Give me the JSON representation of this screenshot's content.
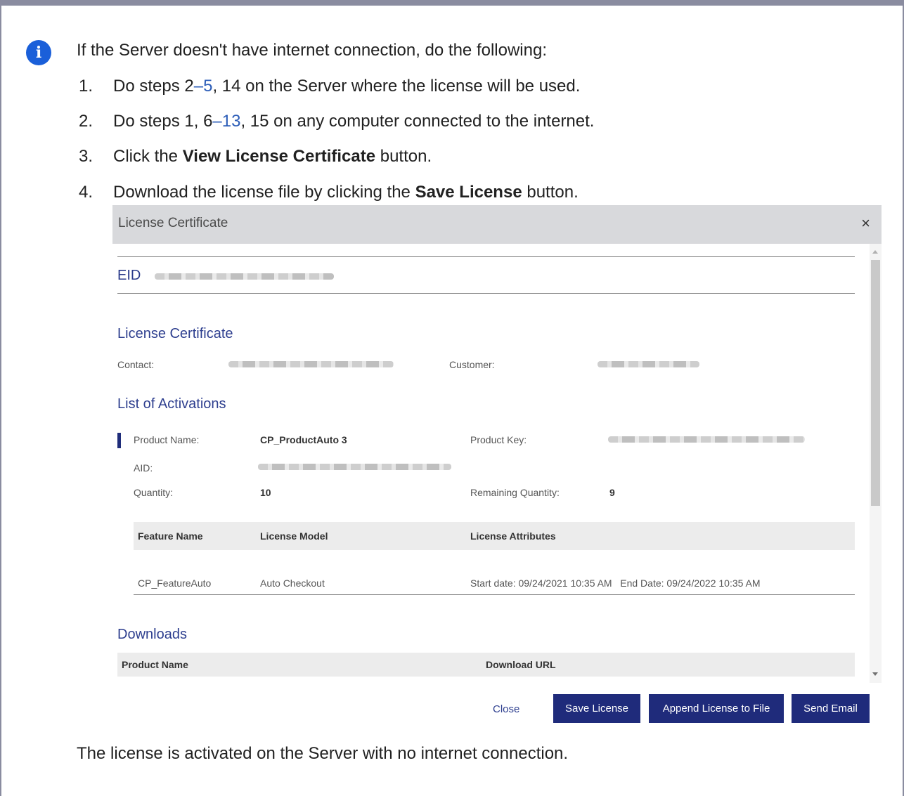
{
  "intro": "If the Server doesn't have internet connection, do the following:",
  "steps": [
    {
      "num": "1.",
      "pre": "Do steps 2",
      "link": "–5",
      "post": ", 14 on the Server where the license will be used."
    },
    {
      "num": "2.",
      "pre": "Do steps 1, 6",
      "link": "–13",
      "post": ", 15 on any computer connected to the internet."
    },
    {
      "num": "3.",
      "pre": "Click the ",
      "bold": "View License Certificate",
      "post": " button."
    },
    {
      "num": "4.",
      "pre": "Download the license file by clicking the ",
      "bold": "Save License",
      "post": " button."
    }
  ],
  "dialog": {
    "title": "License Certificate",
    "close_glyph": "×",
    "eid_label": "EID",
    "section_license": "License Certificate",
    "contact_label": "Contact:",
    "customer_label": "Customer:",
    "section_activations": "List of Activations",
    "product_name_label": "Product Name:",
    "product_name_value": "CP_ProductAuto 3",
    "product_key_label": "Product Key:",
    "aid_label": "AID:",
    "quantity_label": "Quantity:",
    "quantity_value": "10",
    "remaining_label": "Remaining Quantity:",
    "remaining_value": "9",
    "feature_table": {
      "headers": [
        "Feature Name",
        "License Model",
        "License Attributes"
      ],
      "row": [
        "CP_FeatureAuto",
        "Auto Checkout",
        "Start date: 09/24/2021 10:35 AM   End Date: 09/24/2022 10:35 AM"
      ]
    },
    "section_downloads": "Downloads",
    "downloads_headers": [
      "Product Name",
      "Download URL"
    ],
    "buttons": {
      "close": "Close",
      "save": "Save License",
      "append": "Append License to File",
      "email": "Send Email"
    }
  },
  "outro": "The license is activated on the Server with no internet connection.",
  "colors": {
    "accent": "#1f2b7b",
    "heading": "#2e3f8f",
    "info": "#1a5fd9",
    "frame": "#8a8ca0"
  }
}
